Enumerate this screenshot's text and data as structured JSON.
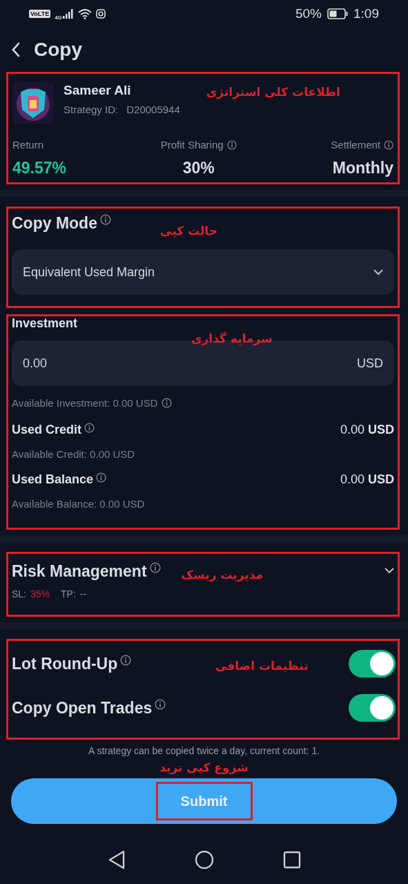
{
  "status_bar": {
    "volte": "VoLTE",
    "network": "4G",
    "battery": "50%",
    "time": "1:09"
  },
  "header": {
    "title": "Copy"
  },
  "strategy": {
    "name": "Sameer Ali",
    "id_label": "Strategy ID:",
    "id": "D20005944",
    "annotation": "اطلاعات کلی استراتژی",
    "stats": [
      {
        "label": "Return",
        "value": "49.57%",
        "info": false,
        "positive": true
      },
      {
        "label": "Profit Sharing",
        "value": "30%",
        "info": true,
        "positive": false
      },
      {
        "label": "Settlement",
        "value": "Monthly",
        "info": true,
        "positive": false
      }
    ]
  },
  "copy_mode": {
    "title": "Copy Mode",
    "annotation": "حالت کپی",
    "select": {
      "value": "Equivalent Used Margin"
    }
  },
  "investment": {
    "title": "Investment",
    "annotation": "سرمایه گذاری",
    "field": {
      "value": "0.00",
      "unit": "USD"
    },
    "available": "Available Investment: 0.00 USD",
    "rows": [
      {
        "label": "Used Credit",
        "amount": "0.00",
        "unit": "USD",
        "note": "Available Credit: 0.00 USD"
      },
      {
        "label": "Used Balance",
        "amount": "0.00",
        "unit": "USD",
        "note": "Available Balance: 0.00 USD"
      }
    ]
  },
  "risk": {
    "title": "Risk Management",
    "annotation": "مدیریت ریسک",
    "sl_label": "SL:",
    "sl": "35%",
    "tp_label": "TP:",
    "tp": "--"
  },
  "settings": {
    "annotation": "تنظیمات اضافی",
    "toggles": [
      {
        "label": "Lot Round-Up",
        "on": true
      },
      {
        "label": "Copy Open Trades",
        "on": true
      }
    ]
  },
  "note": "A strategy can be copied twice a day, current count: 1.",
  "submit_annotation": "شزوع کپی ترید",
  "submit": "Submit"
}
